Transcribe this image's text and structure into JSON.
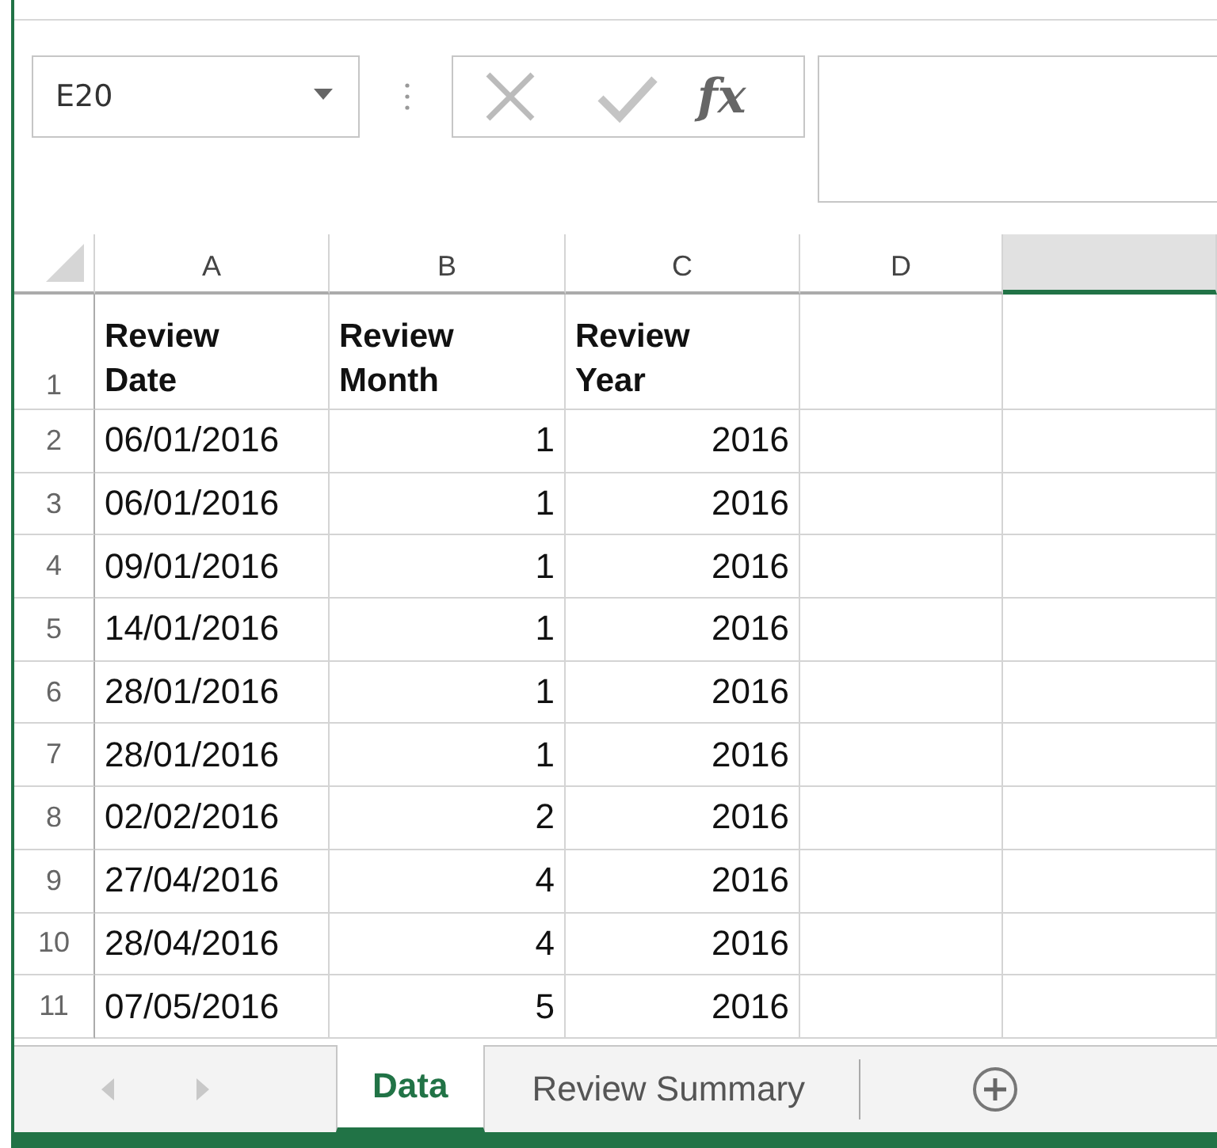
{
  "name_box": {
    "value": "E20"
  },
  "formula_bar": {
    "function_label": "fx"
  },
  "columns": [
    {
      "label": "A",
      "selected": false,
      "kind": "date"
    },
    {
      "label": "B",
      "selected": false,
      "kind": "number"
    },
    {
      "label": "C",
      "selected": false,
      "kind": "number"
    },
    {
      "label": "D",
      "selected": false,
      "kind": "empty"
    },
    {
      "selected": true
    }
  ],
  "rows": [
    {
      "number": "1",
      "kind": "header",
      "cells": [
        "Review\nDate",
        "Review\nMonth",
        "Review\nYear"
      ]
    },
    {
      "number": "2",
      "kind": "data",
      "cells": [
        "06/01/2016",
        "1",
        "2016"
      ]
    },
    {
      "number": "3",
      "kind": "data",
      "cells": [
        "06/01/2016",
        "1",
        "2016"
      ]
    },
    {
      "number": "4",
      "kind": "data",
      "cells": [
        "09/01/2016",
        "1",
        "2016"
      ]
    },
    {
      "number": "5",
      "kind": "data",
      "cells": [
        "14/01/2016",
        "1",
        "2016"
      ]
    },
    {
      "number": "6",
      "kind": "data",
      "cells": [
        "28/01/2016",
        "1",
        "2016"
      ]
    },
    {
      "number": "7",
      "kind": "data",
      "cells": [
        "28/01/2016",
        "1",
        "2016"
      ]
    },
    {
      "number": "8",
      "kind": "data",
      "cells": [
        "02/02/2016",
        "2",
        "2016"
      ]
    },
    {
      "number": "9",
      "kind": "data",
      "cells": [
        "27/04/2016",
        "4",
        "2016"
      ]
    },
    {
      "number": "10",
      "kind": "data",
      "cells": [
        "28/04/2016",
        "4",
        "2016"
      ]
    },
    {
      "number": "11",
      "kind": "data",
      "cells": [
        "07/05/2016",
        "5",
        "2016"
      ]
    }
  ],
  "sheet_tabs": [
    {
      "label": "Data",
      "selected": true
    },
    {
      "label": "Review Summary",
      "selected": false
    }
  ]
}
